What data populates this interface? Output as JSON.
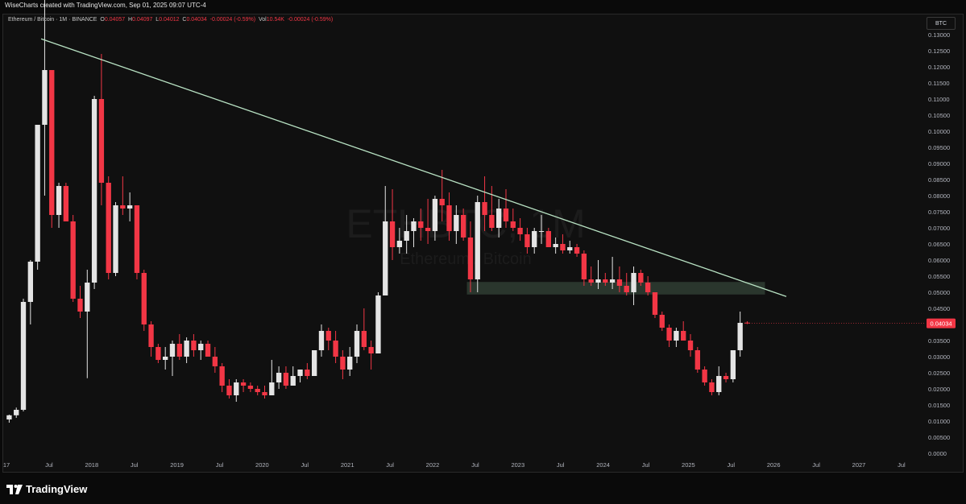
{
  "header": {
    "caption": "WiseCharts created with TradingView.com, Sep 01, 2025 09:07 UTC-4"
  },
  "legend": {
    "symbol": "Ethereum / Bitcoin · 1M · BINANCE",
    "o_label": "O",
    "o_value": "0.04057",
    "h_label": "H",
    "h_value": "0.04097",
    "l_label": "L",
    "l_value": "0.04012",
    "c_label": "C",
    "c_value": "0.04034",
    "change": "-0.00024 (-0.59%)",
    "vol_label": "Vol",
    "vol_value": "10.54K",
    "vol_change": "-0.00024 (-0.59%)"
  },
  "currency_badge": "BTC",
  "watermark": {
    "ticker": "ETHBTC, 1M",
    "name": "Ethereum / Bitcoin"
  },
  "footer": {
    "brand": "TradingView"
  },
  "colors": {
    "bull": "#e4e4e4",
    "bear": "#f23645",
    "trendline": "#b9e3c4",
    "zone": "#2f3d33",
    "price_badge": "#f23645",
    "axis_text": "#b2b5be"
  },
  "chart_data": {
    "type": "candlestick",
    "price_axis": {
      "ticks": [
        "0.13000",
        "0.12500",
        "0.12000",
        "0.11500",
        "0.11000",
        "0.10500",
        "0.10000",
        "0.09500",
        "0.09000",
        "0.08500",
        "0.08000",
        "0.07500",
        "0.07000",
        "0.06500",
        "0.06000",
        "0.05500",
        "0.05000",
        "0.04500",
        "0.04000",
        "0.03500",
        "0.03000",
        "0.02500",
        "0.02000",
        "0.01500",
        "0.01000",
        "0.00500",
        "0.0000"
      ],
      "ylim": [
        0.0,
        0.13
      ]
    },
    "time_axis": {
      "labels": [
        "17",
        "Jul",
        "2018",
        "Jul",
        "2019",
        "Jul",
        "2020",
        "Jul",
        "2021",
        "Jul",
        "2022",
        "Jul",
        "2023",
        "Jul",
        "2024",
        "Jul",
        "2025",
        "Jul",
        "2026",
        "Jul",
        "2027",
        "Jul"
      ],
      "range": [
        "2017-01",
        "2027-12"
      ]
    },
    "last_price": "0.04034",
    "trendline": [
      {
        "date": "2017-06",
        "value": 0.1287
      },
      {
        "date": "2026-03",
        "value": 0.0487
      }
    ],
    "support_zone": {
      "from": "2022-06",
      "to": "2025-12",
      "low": 0.0493,
      "high": 0.0532
    },
    "candles": [
      {
        "t": "2017-01",
        "o": 0.0105,
        "h": 0.012,
        "l": 0.0095,
        "c": 0.0118
      },
      {
        "t": "2017-02",
        "o": 0.0118,
        "h": 0.0142,
        "l": 0.011,
        "c": 0.0135
      },
      {
        "t": "2017-03",
        "o": 0.0135,
        "h": 0.048,
        "l": 0.013,
        "c": 0.047
      },
      {
        "t": "2017-04",
        "o": 0.047,
        "h": 0.06,
        "l": 0.04,
        "c": 0.0595
      },
      {
        "t": "2017-05",
        "o": 0.0595,
        "h": 0.102,
        "l": 0.057,
        "c": 0.102
      },
      {
        "t": "2017-06",
        "o": 0.102,
        "h": 0.1555,
        "l": 0.08,
        "c": 0.119
      },
      {
        "t": "2017-07",
        "o": 0.119,
        "h": 0.119,
        "l": 0.07,
        "c": 0.074
      },
      {
        "t": "2017-08",
        "o": 0.074,
        "h": 0.084,
        "l": 0.07,
        "c": 0.083
      },
      {
        "t": "2017-09",
        "o": 0.083,
        "h": 0.084,
        "l": 0.072,
        "c": 0.072
      },
      {
        "t": "2017-10",
        "o": 0.072,
        "h": 0.074,
        "l": 0.047,
        "c": 0.048
      },
      {
        "t": "2017-11",
        "o": 0.048,
        "h": 0.052,
        "l": 0.042,
        "c": 0.044
      },
      {
        "t": "2017-12",
        "o": 0.044,
        "h": 0.057,
        "l": 0.0233,
        "c": 0.053
      },
      {
        "t": "2018-01",
        "o": 0.053,
        "h": 0.111,
        "l": 0.051,
        "c": 0.11
      },
      {
        "t": "2018-02",
        "o": 0.11,
        "h": 0.124,
        "l": 0.077,
        "c": 0.084
      },
      {
        "t": "2018-03",
        "o": 0.084,
        "h": 0.086,
        "l": 0.054,
        "c": 0.056
      },
      {
        "t": "2018-04",
        "o": 0.056,
        "h": 0.078,
        "l": 0.055,
        "c": 0.077
      },
      {
        "t": "2018-05",
        "o": 0.077,
        "h": 0.086,
        "l": 0.074,
        "c": 0.076
      },
      {
        "t": "2018-06",
        "o": 0.076,
        "h": 0.081,
        "l": 0.072,
        "c": 0.077
      },
      {
        "t": "2018-07",
        "o": 0.077,
        "h": 0.077,
        "l": 0.054,
        "c": 0.056
      },
      {
        "t": "2018-08",
        "o": 0.056,
        "h": 0.057,
        "l": 0.038,
        "c": 0.04
      },
      {
        "t": "2018-09",
        "o": 0.04,
        "h": 0.041,
        "l": 0.03,
        "c": 0.033
      },
      {
        "t": "2018-10",
        "o": 0.033,
        "h": 0.034,
        "l": 0.028,
        "c": 0.029
      },
      {
        "t": "2018-11",
        "o": 0.029,
        "h": 0.033,
        "l": 0.026,
        "c": 0.03
      },
      {
        "t": "2018-12",
        "o": 0.03,
        "h": 0.035,
        "l": 0.024,
        "c": 0.034
      },
      {
        "t": "2019-01",
        "o": 0.034,
        "h": 0.037,
        "l": 0.029,
        "c": 0.03
      },
      {
        "t": "2019-02",
        "o": 0.03,
        "h": 0.036,
        "l": 0.028,
        "c": 0.035
      },
      {
        "t": "2019-03",
        "o": 0.035,
        "h": 0.037,
        "l": 0.03,
        "c": 0.032
      },
      {
        "t": "2019-04",
        "o": 0.032,
        "h": 0.035,
        "l": 0.029,
        "c": 0.034
      },
      {
        "t": "2019-05",
        "o": 0.034,
        "h": 0.035,
        "l": 0.03,
        "c": 0.03
      },
      {
        "t": "2019-06",
        "o": 0.03,
        "h": 0.033,
        "l": 0.025,
        "c": 0.027
      },
      {
        "t": "2019-07",
        "o": 0.027,
        "h": 0.028,
        "l": 0.019,
        "c": 0.021
      },
      {
        "t": "2019-08",
        "o": 0.021,
        "h": 0.023,
        "l": 0.017,
        "c": 0.018
      },
      {
        "t": "2019-09",
        "o": 0.018,
        "h": 0.023,
        "l": 0.016,
        "c": 0.022
      },
      {
        "t": "2019-10",
        "o": 0.022,
        "h": 0.023,
        "l": 0.019,
        "c": 0.021
      },
      {
        "t": "2019-11",
        "o": 0.021,
        "h": 0.022,
        "l": 0.019,
        "c": 0.02
      },
      {
        "t": "2019-12",
        "o": 0.02,
        "h": 0.021,
        "l": 0.018,
        "c": 0.019
      },
      {
        "t": "2020-01",
        "o": 0.019,
        "h": 0.021,
        "l": 0.017,
        "c": 0.018
      },
      {
        "t": "2020-02",
        "o": 0.018,
        "h": 0.029,
        "l": 0.018,
        "c": 0.022
      },
      {
        "t": "2020-03",
        "o": 0.022,
        "h": 0.027,
        "l": 0.02,
        "c": 0.025
      },
      {
        "t": "2020-04",
        "o": 0.025,
        "h": 0.027,
        "l": 0.02,
        "c": 0.021
      },
      {
        "t": "2020-05",
        "o": 0.021,
        "h": 0.027,
        "l": 0.021,
        "c": 0.024
      },
      {
        "t": "2020-06",
        "o": 0.024,
        "h": 0.026,
        "l": 0.022,
        "c": 0.026
      },
      {
        "t": "2020-07",
        "o": 0.026,
        "h": 0.028,
        "l": 0.023,
        "c": 0.024
      },
      {
        "t": "2020-08",
        "o": 0.024,
        "h": 0.032,
        "l": 0.024,
        "c": 0.032
      },
      {
        "t": "2020-09",
        "o": 0.032,
        "h": 0.04,
        "l": 0.03,
        "c": 0.038
      },
      {
        "t": "2020-10",
        "o": 0.038,
        "h": 0.039,
        "l": 0.032,
        "c": 0.035
      },
      {
        "t": "2020-11",
        "o": 0.035,
        "h": 0.038,
        "l": 0.028,
        "c": 0.03
      },
      {
        "t": "2020-12",
        "o": 0.03,
        "h": 0.032,
        "l": 0.023,
        "c": 0.026
      },
      {
        "t": "2021-01",
        "o": 0.026,
        "h": 0.033,
        "l": 0.024,
        "c": 0.03
      },
      {
        "t": "2021-02",
        "o": 0.03,
        "h": 0.04,
        "l": 0.028,
        "c": 0.038
      },
      {
        "t": "2021-03",
        "o": 0.038,
        "h": 0.045,
        "l": 0.032,
        "c": 0.033
      },
      {
        "t": "2021-04",
        "o": 0.033,
        "h": 0.035,
        "l": 0.026,
        "c": 0.031
      },
      {
        "t": "2021-05",
        "o": 0.031,
        "h": 0.05,
        "l": 0.031,
        "c": 0.049
      },
      {
        "t": "2021-06",
        "o": 0.049,
        "h": 0.083,
        "l": 0.049,
        "c": 0.072
      },
      {
        "t": "2021-07",
        "o": 0.072,
        "h": 0.082,
        "l": 0.06,
        "c": 0.064
      },
      {
        "t": "2021-08",
        "o": 0.064,
        "h": 0.07,
        "l": 0.062,
        "c": 0.066
      },
      {
        "t": "2021-09",
        "o": 0.066,
        "h": 0.074,
        "l": 0.062,
        "c": 0.069
      },
      {
        "t": "2021-10",
        "o": 0.069,
        "h": 0.073,
        "l": 0.064,
        "c": 0.072
      },
      {
        "t": "2021-11",
        "o": 0.072,
        "h": 0.076,
        "l": 0.066,
        "c": 0.07
      },
      {
        "t": "2021-12",
        "o": 0.07,
        "h": 0.079,
        "l": 0.065,
        "c": 0.069
      },
      {
        "t": "2022-01",
        "o": 0.069,
        "h": 0.08,
        "l": 0.066,
        "c": 0.079
      },
      {
        "t": "2022-02",
        "o": 0.079,
        "h": 0.088,
        "l": 0.072,
        "c": 0.077
      },
      {
        "t": "2022-03",
        "o": 0.077,
        "h": 0.081,
        "l": 0.066,
        "c": 0.069
      },
      {
        "t": "2022-04",
        "o": 0.069,
        "h": 0.077,
        "l": 0.065,
        "c": 0.074
      },
      {
        "t": "2022-05",
        "o": 0.074,
        "h": 0.076,
        "l": 0.066,
        "c": 0.067
      },
      {
        "t": "2022-06",
        "o": 0.067,
        "h": 0.072,
        "l": 0.05,
        "c": 0.054
      },
      {
        "t": "2022-07",
        "o": 0.054,
        "h": 0.08,
        "l": 0.05,
        "c": 0.078
      },
      {
        "t": "2022-08",
        "o": 0.078,
        "h": 0.086,
        "l": 0.069,
        "c": 0.074
      },
      {
        "t": "2022-09",
        "o": 0.074,
        "h": 0.083,
        "l": 0.069,
        "c": 0.07
      },
      {
        "t": "2022-10",
        "o": 0.07,
        "h": 0.079,
        "l": 0.067,
        "c": 0.076
      },
      {
        "t": "2022-11",
        "o": 0.076,
        "h": 0.082,
        "l": 0.07,
        "c": 0.072
      },
      {
        "t": "2022-12",
        "o": 0.072,
        "h": 0.076,
        "l": 0.069,
        "c": 0.07
      },
      {
        "t": "2023-01",
        "o": 0.07,
        "h": 0.073,
        "l": 0.066,
        "c": 0.068
      },
      {
        "t": "2023-02",
        "o": 0.068,
        "h": 0.07,
        "l": 0.062,
        "c": 0.064
      },
      {
        "t": "2023-03",
        "o": 0.064,
        "h": 0.07,
        "l": 0.062,
        "c": 0.069
      },
      {
        "t": "2023-04",
        "o": 0.069,
        "h": 0.074,
        "l": 0.065,
        "c": 0.069
      },
      {
        "t": "2023-05",
        "o": 0.069,
        "h": 0.07,
        "l": 0.064,
        "c": 0.064
      },
      {
        "t": "2023-06",
        "o": 0.064,
        "h": 0.067,
        "l": 0.062,
        "c": 0.065
      },
      {
        "t": "2023-07",
        "o": 0.065,
        "h": 0.068,
        "l": 0.062,
        "c": 0.063
      },
      {
        "t": "2023-08",
        "o": 0.063,
        "h": 0.066,
        "l": 0.062,
        "c": 0.064
      },
      {
        "t": "2023-09",
        "o": 0.064,
        "h": 0.065,
        "l": 0.061,
        "c": 0.062
      },
      {
        "t": "2023-10",
        "o": 0.062,
        "h": 0.063,
        "l": 0.052,
        "c": 0.054
      },
      {
        "t": "2023-11",
        "o": 0.054,
        "h": 0.058,
        "l": 0.052,
        "c": 0.053
      },
      {
        "t": "2023-12",
        "o": 0.053,
        "h": 0.06,
        "l": 0.051,
        "c": 0.054
      },
      {
        "t": "2024-01",
        "o": 0.054,
        "h": 0.056,
        "l": 0.052,
        "c": 0.053
      },
      {
        "t": "2024-02",
        "o": 0.053,
        "h": 0.061,
        "l": 0.051,
        "c": 0.054
      },
      {
        "t": "2024-03",
        "o": 0.054,
        "h": 0.058,
        "l": 0.05,
        "c": 0.052
      },
      {
        "t": "2024-04",
        "o": 0.052,
        "h": 0.056,
        "l": 0.049,
        "c": 0.05
      },
      {
        "t": "2024-05",
        "o": 0.05,
        "h": 0.058,
        "l": 0.046,
        "c": 0.056
      },
      {
        "t": "2024-06",
        "o": 0.056,
        "h": 0.057,
        "l": 0.052,
        "c": 0.053
      },
      {
        "t": "2024-07",
        "o": 0.053,
        "h": 0.055,
        "l": 0.049,
        "c": 0.05
      },
      {
        "t": "2024-08",
        "o": 0.05,
        "h": 0.05,
        "l": 0.042,
        "c": 0.043
      },
      {
        "t": "2024-09",
        "o": 0.043,
        "h": 0.044,
        "l": 0.038,
        "c": 0.039
      },
      {
        "t": "2024-10",
        "o": 0.039,
        "h": 0.04,
        "l": 0.033,
        "c": 0.035
      },
      {
        "t": "2024-11",
        "o": 0.035,
        "h": 0.039,
        "l": 0.033,
        "c": 0.038
      },
      {
        "t": "2024-12",
        "o": 0.038,
        "h": 0.041,
        "l": 0.035,
        "c": 0.035
      },
      {
        "t": "2025-01",
        "o": 0.035,
        "h": 0.037,
        "l": 0.03,
        "c": 0.032
      },
      {
        "t": "2025-02",
        "o": 0.032,
        "h": 0.033,
        "l": 0.025,
        "c": 0.026
      },
      {
        "t": "2025-03",
        "o": 0.026,
        "h": 0.027,
        "l": 0.021,
        "c": 0.022
      },
      {
        "t": "2025-04",
        "o": 0.022,
        "h": 0.023,
        "l": 0.018,
        "c": 0.019
      },
      {
        "t": "2025-05",
        "o": 0.019,
        "h": 0.027,
        "l": 0.018,
        "c": 0.024
      },
      {
        "t": "2025-06",
        "o": 0.024,
        "h": 0.025,
        "l": 0.022,
        "c": 0.023
      },
      {
        "t": "2025-07",
        "o": 0.023,
        "h": 0.032,
        "l": 0.022,
        "c": 0.032
      },
      {
        "t": "2025-08",
        "o": 0.032,
        "h": 0.044,
        "l": 0.03,
        "c": 0.0405
      },
      {
        "t": "2025-09",
        "o": 0.04057,
        "h": 0.04097,
        "l": 0.04012,
        "c": 0.04034
      }
    ]
  }
}
